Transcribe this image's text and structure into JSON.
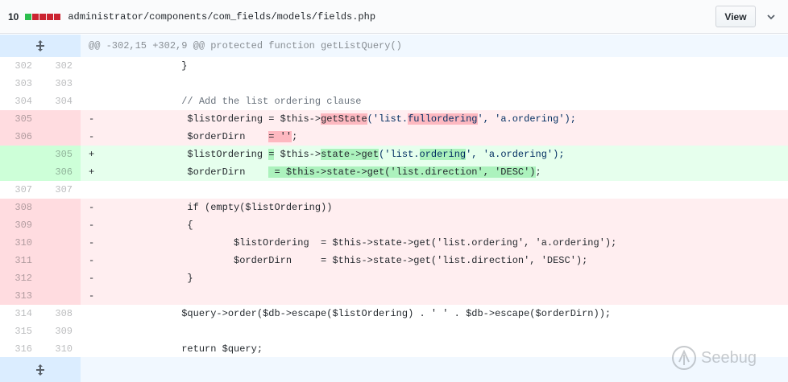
{
  "header": {
    "change_count": "10",
    "file_path": "administrator/components/com_fields/models/fields.php",
    "view_label": "View"
  },
  "hunk": {
    "header": "@@ -302,15 +302,9 @@ protected function getListQuery()"
  },
  "lines": {
    "l302": {
      "old": "302",
      "new": "302",
      "code": "                }"
    },
    "l303": {
      "old": "303",
      "new": "303",
      "code": ""
    },
    "l304": {
      "old": "304",
      "new": "304",
      "code": "                // Add the list ordering clause"
    },
    "l305d": {
      "old": "305",
      "sign": "-",
      "pre": "                $listOrdering = $this->",
      "m1": "getState",
      "mid1": "('list.",
      "m2": "fullordering",
      "post": "', 'a.ordering');"
    },
    "l306d": {
      "old": "306",
      "sign": "-",
      "pre": "                $orderDirn    ",
      "m1": "= ''",
      "post": ";"
    },
    "l305a": {
      "new": "305",
      "sign": "+",
      "pre": "                $listOrdering ",
      "m1": "=",
      "mid1": " $this->",
      "m2": "state->get",
      "mid2": "('list.",
      "m3": "ordering",
      "post": "', 'a.ordering');"
    },
    "l306a": {
      "new": "306",
      "sign": "+",
      "pre": "                $orderDirn    ",
      "m1": " = $this->state->get('list.direction', 'DESC')",
      "post": ";"
    },
    "l307": {
      "old": "307",
      "new": "307",
      "code": ""
    },
    "l308": {
      "old": "308",
      "sign": "-",
      "code": "                if (empty($listOrdering))"
    },
    "l309": {
      "old": "309",
      "sign": "-",
      "code": "                {"
    },
    "l310": {
      "old": "310",
      "sign": "-",
      "code": "                        $listOrdering  = $this->state->get('list.ordering', 'a.ordering');"
    },
    "l311": {
      "old": "311",
      "sign": "-",
      "code": "                        $orderDirn     = $this->state->get('list.direction', 'DESC');"
    },
    "l312": {
      "old": "312",
      "sign": "-",
      "code": "                }"
    },
    "l313": {
      "old": "313",
      "sign": "-",
      "code": ""
    },
    "l314": {
      "old": "314",
      "new": "308",
      "code": "                $query->order($db->escape($listOrdering) . ' ' . $db->escape($orderDirn));"
    },
    "l315": {
      "old": "315",
      "new": "309",
      "code": ""
    },
    "l316": {
      "old": "316",
      "new": "310",
      "code": "                return $query;"
    }
  },
  "watermark": {
    "text": "Seebug"
  },
  "colors": {
    "deleted_block": "#cb2431",
    "added_block": "#2cbe4e",
    "neutral_block": "#d1d5da"
  },
  "icons": {
    "expand": "unfold-icon",
    "menu": "chevron-down-icon",
    "watermark_logo": "seebug-logo"
  }
}
